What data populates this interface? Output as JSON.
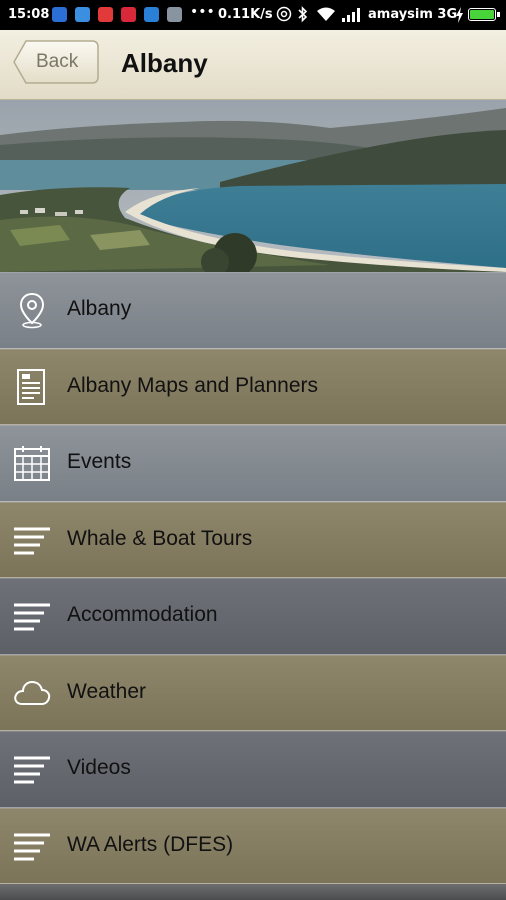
{
  "status_bar": {
    "time": "15:08",
    "network_speed": "0.11K/s",
    "carrier": "amaysim 3G"
  },
  "header": {
    "back_label": "Back",
    "title": "Albany"
  },
  "menu": {
    "items": [
      {
        "label": "Albany",
        "icon": "map-pin-icon"
      },
      {
        "label": "Albany Maps and Planners",
        "icon": "document-icon"
      },
      {
        "label": "Events",
        "icon": "calendar-icon"
      },
      {
        "label": "Whale & Boat Tours",
        "icon": "list-lines-icon"
      },
      {
        "label": "Accommodation",
        "icon": "list-lines-icon"
      },
      {
        "label": "Weather",
        "icon": "cloud-icon"
      },
      {
        "label": "Videos",
        "icon": "list-lines-icon"
      },
      {
        "label": "WA Alerts (DFES)",
        "icon": "list-lines-icon"
      }
    ]
  },
  "colors": {
    "header_bg": "#ebe6d3",
    "menu_grey": "#868c92",
    "menu_olive": "#877f64",
    "battery": "#49d33b"
  }
}
